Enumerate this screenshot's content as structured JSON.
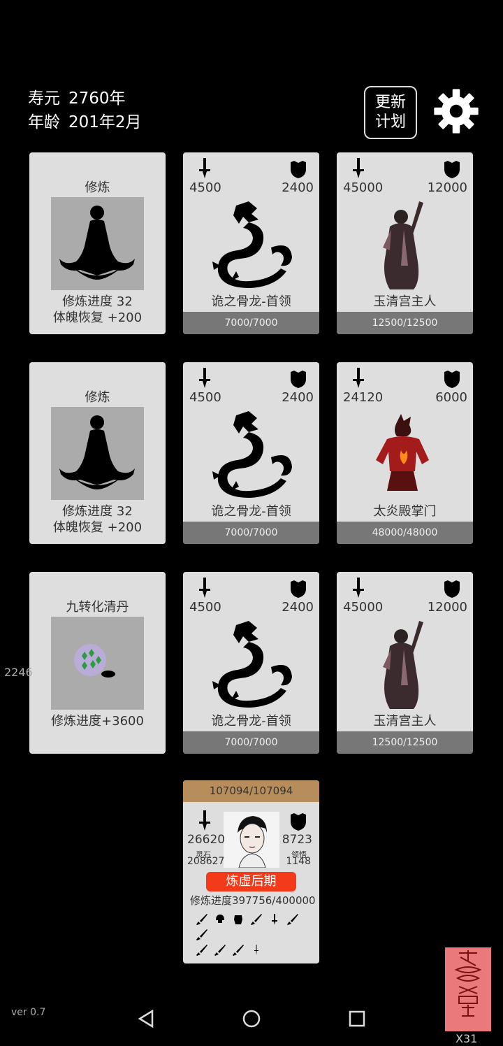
{
  "hud": {
    "lifespan_label": "寿元",
    "lifespan_value": "2760年",
    "age_label": "年龄",
    "age_value": "201年2月",
    "plan_button": [
      "更新",
      "计划"
    ]
  },
  "cards": [
    {
      "kind": "cultivate",
      "title": "修炼",
      "line1": "修炼进度  32",
      "line2": "体魄恢复  +200"
    },
    {
      "kind": "enemy",
      "atk": "4500",
      "def": "2400",
      "name": "诡之骨龙-首领",
      "hp": "7000/7000",
      "art": "dragon"
    },
    {
      "kind": "enemy",
      "atk": "45000",
      "def": "12000",
      "name": "玉清宫主人",
      "hp": "12500/12500",
      "art": "master"
    },
    {
      "kind": "cultivate",
      "title": "修炼",
      "line1": "修炼进度  32",
      "line2": "体魄恢复  +200"
    },
    {
      "kind": "enemy",
      "atk": "4500",
      "def": "2400",
      "name": "诡之骨龙-首领",
      "hp": "7000/7000",
      "art": "dragon"
    },
    {
      "kind": "enemy",
      "atk": "24120",
      "def": "6000",
      "name": "太炎殿掌门",
      "hp": "48000/48000",
      "art": "flame"
    },
    {
      "kind": "pill",
      "title": "九转化清丹",
      "line1": "修炼进度+3600"
    },
    {
      "kind": "enemy",
      "atk": "4500",
      "def": "2400",
      "name": "诡之骨龙-首领",
      "hp": "7000/7000",
      "art": "dragon"
    },
    {
      "kind": "enemy",
      "atk": "45000",
      "def": "12000",
      "name": "玉清宫主人",
      "hp": "12500/12500",
      "art": "master"
    }
  ],
  "side_number": "2246",
  "player": {
    "hp": "107094/107094",
    "atk": "26620",
    "def": "8723",
    "spirit_stone_label": "灵石",
    "spirit_stone_value": "208627",
    "insight_label": "领悟",
    "insight_value": "1148",
    "realm": "炼虚后期",
    "progress_label": "修炼进度",
    "progress_value": "397756/400000"
  },
  "version": "ver 0.7",
  "multiplier": "X31",
  "colors": {
    "realm_badge": "#f33a1a",
    "hp_bar": "#b88d5c",
    "talisman": "#e9797a"
  }
}
